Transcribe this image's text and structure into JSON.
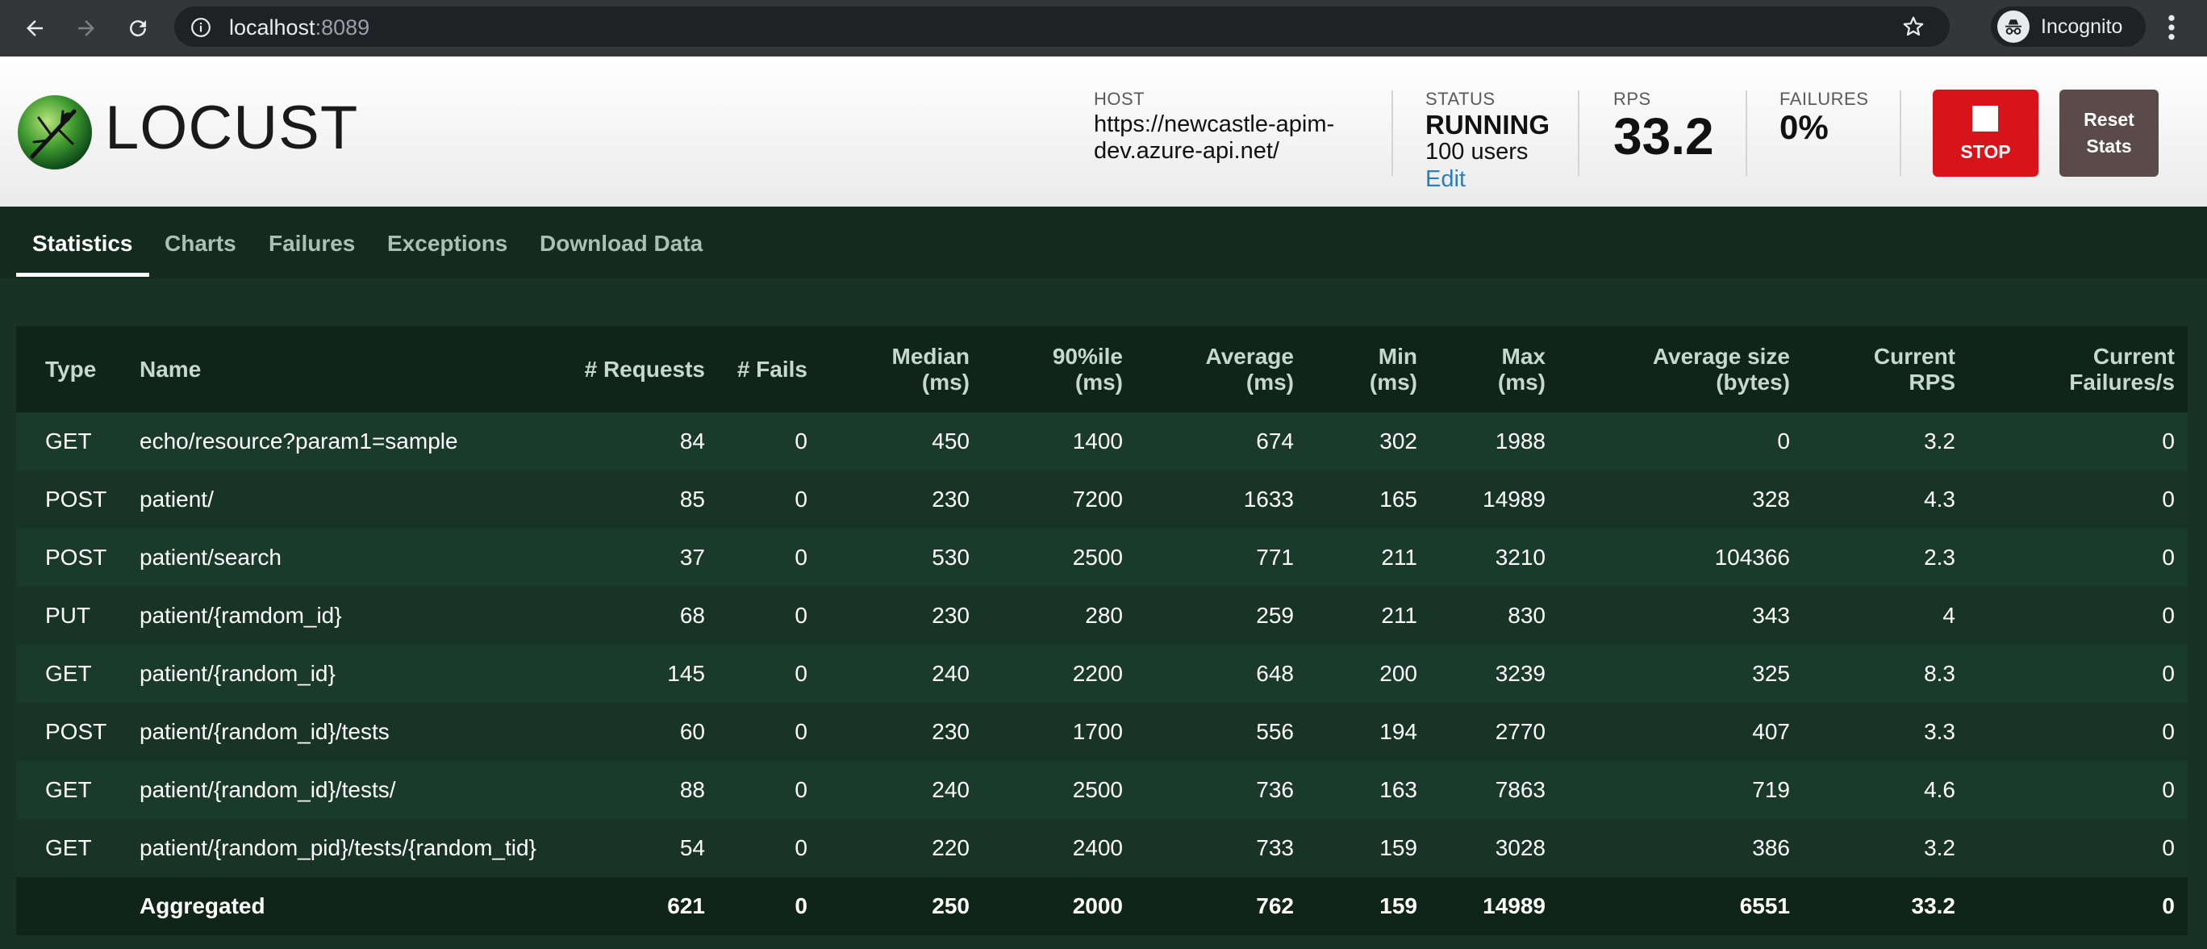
{
  "browser": {
    "url_host": "localhost",
    "url_port": ":8089",
    "incognito_label": "Incognito"
  },
  "header": {
    "logo_text": "LOCUST",
    "host_label": "HOST",
    "host_value": "https://newcastle-apim-dev.azure-api.net/",
    "status_label": "STATUS",
    "status_value": "RUNNING",
    "users_value": "100 users",
    "edit_label": "Edit",
    "rps_label": "RPS",
    "rps_value": "33.2",
    "failures_label": "FAILURES",
    "failures_value": "0%",
    "stop_label": "STOP",
    "reset_line1": "Reset",
    "reset_line2": "Stats"
  },
  "tabs": [
    {
      "label": "Statistics",
      "active": true
    },
    {
      "label": "Charts",
      "active": false
    },
    {
      "label": "Failures",
      "active": false
    },
    {
      "label": "Exceptions",
      "active": false
    },
    {
      "label": "Download Data",
      "active": false
    }
  ],
  "table": {
    "headers": {
      "type": "Type",
      "name": "Name",
      "requests": "# Requests",
      "fails": "# Fails",
      "median_1": "Median",
      "median_2": "(ms)",
      "p90_1": "90%ile",
      "p90_2": "(ms)",
      "avg_1": "Average",
      "avg_2": "(ms)",
      "min_1": "Min",
      "min_2": "(ms)",
      "max_1": "Max",
      "max_2": "(ms)",
      "size_1": "Average size",
      "size_2": "(bytes)",
      "rps_1": "Current",
      "rps_2": "RPS",
      "fps_1": "Current",
      "fps_2": "Failures/s"
    },
    "rows": [
      [
        "GET",
        "echo/resource?param1=sample",
        "84",
        "0",
        "450",
        "1400",
        "674",
        "302",
        "1988",
        "0",
        "3.2",
        "0"
      ],
      [
        "POST",
        "patient/",
        "85",
        "0",
        "230",
        "7200",
        "1633",
        "165",
        "14989",
        "328",
        "4.3",
        "0"
      ],
      [
        "POST",
        "patient/search",
        "37",
        "0",
        "530",
        "2500",
        "771",
        "211",
        "3210",
        "104366",
        "2.3",
        "0"
      ],
      [
        "PUT",
        "patient/{ramdom_id}",
        "68",
        "0",
        "230",
        "280",
        "259",
        "211",
        "830",
        "343",
        "4",
        "0"
      ],
      [
        "GET",
        "patient/{random_id}",
        "145",
        "0",
        "240",
        "2200",
        "648",
        "200",
        "3239",
        "325",
        "8.3",
        "0"
      ],
      [
        "POST",
        "patient/{random_id}/tests",
        "60",
        "0",
        "230",
        "1700",
        "556",
        "194",
        "2770",
        "407",
        "3.3",
        "0"
      ],
      [
        "GET",
        "patient/{random_id}/tests/",
        "88",
        "0",
        "240",
        "2500",
        "736",
        "163",
        "7863",
        "719",
        "4.6",
        "0"
      ],
      [
        "GET",
        "patient/{random_pid}/tests/{random_tid}",
        "54",
        "0",
        "220",
        "2400",
        "733",
        "159",
        "3028",
        "386",
        "3.2",
        "0"
      ]
    ],
    "aggregated": [
      "",
      "Aggregated",
      "621",
      "0",
      "250",
      "2000",
      "762",
      "159",
      "14989",
      "6551",
      "33.2",
      "0"
    ]
  },
  "colors": {
    "accent_edit": "#2a7ec0",
    "stop_button": "#d8131a",
    "reset_button": "#5a4a4a",
    "page_bg": "#183227"
  }
}
